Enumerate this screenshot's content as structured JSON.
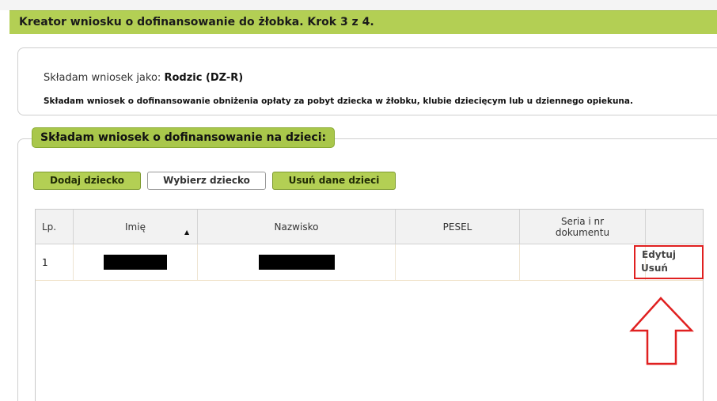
{
  "header": {
    "title": "Kreator wniosku o dofinansowanie do żłobka. Krok 3 z 4."
  },
  "applicant": {
    "role_prefix": "Składam wniosek jako:",
    "role_value": "Rodzic (DZ-R)",
    "description": "Składam wniosek o dofinansowanie obniżenia opłaty za pobyt dziecka w żłobku, klubie dziecięcym lub u dziennego opiekuna."
  },
  "children_section": {
    "legend": "Składam wniosek o dofinansowanie na dzieci:",
    "buttons": {
      "add": "Dodaj dziecko",
      "select": "Wybierz dziecko",
      "remove": "Usuń dane dzieci"
    },
    "table": {
      "columns": [
        "Lp.",
        "Imię",
        "Nazwisko",
        "PESEL",
        "Seria i nr dokumentu",
        ""
      ],
      "rows": [
        {
          "lp": "1",
          "pesel": "",
          "document": "",
          "actions": {
            "edit": "Edytuj",
            "delete": "Usuń"
          }
        }
      ]
    }
  },
  "colors": {
    "accent_green": "#b3cf54",
    "highlight_red": "#e02020"
  },
  "icons": {
    "sort": "sort-asc-icon",
    "pointer": "up-arrow-annotation-icon"
  }
}
